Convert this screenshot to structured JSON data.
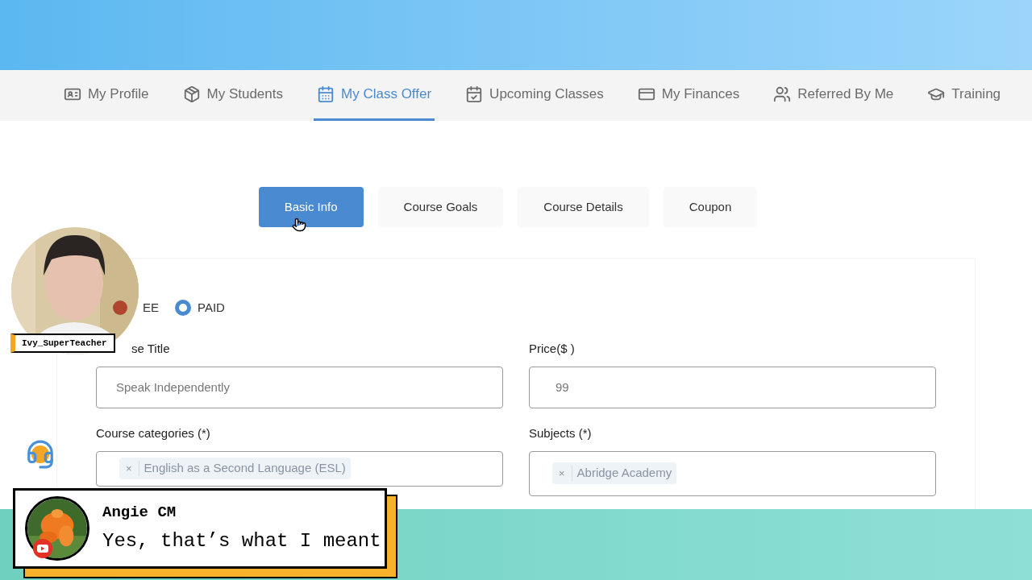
{
  "nav": [
    {
      "label": "My Profile",
      "selected": false
    },
    {
      "label": "My Students",
      "selected": false
    },
    {
      "label": "My Class Offer",
      "selected": true
    },
    {
      "label": "Upcoming Classes",
      "selected": false
    },
    {
      "label": "My Finances",
      "selected": false
    },
    {
      "label": "Referred By Me",
      "selected": false
    },
    {
      "label": "Training",
      "selected": false
    }
  ],
  "steps": [
    {
      "label": "Basic Info",
      "selected": true
    },
    {
      "label": "Course Goals",
      "selected": false
    },
    {
      "label": "Course Details",
      "selected": false
    },
    {
      "label": "Coupon",
      "selected": false
    }
  ],
  "pricing": {
    "free_label": "EE",
    "paid": {
      "label": "PAID",
      "selected": true
    }
  },
  "form": {
    "title_label": "se Title",
    "title_value": "Speak Independently",
    "price_label": "Price($ )",
    "price_value": "99",
    "categories_label": "Course categories (*)",
    "categories": [
      {
        "remove": "×",
        "text": "English as a Second Language (ESL)"
      }
    ],
    "subjects_label": "Subjects (*)",
    "subjects": [
      {
        "remove": "×",
        "text": "Abridge Academy"
      }
    ]
  },
  "webcam": {
    "name": "Ivy_SuperTeacher"
  },
  "chat": {
    "author": "Angie CM",
    "message": "Yes, that’s what I meant"
  }
}
